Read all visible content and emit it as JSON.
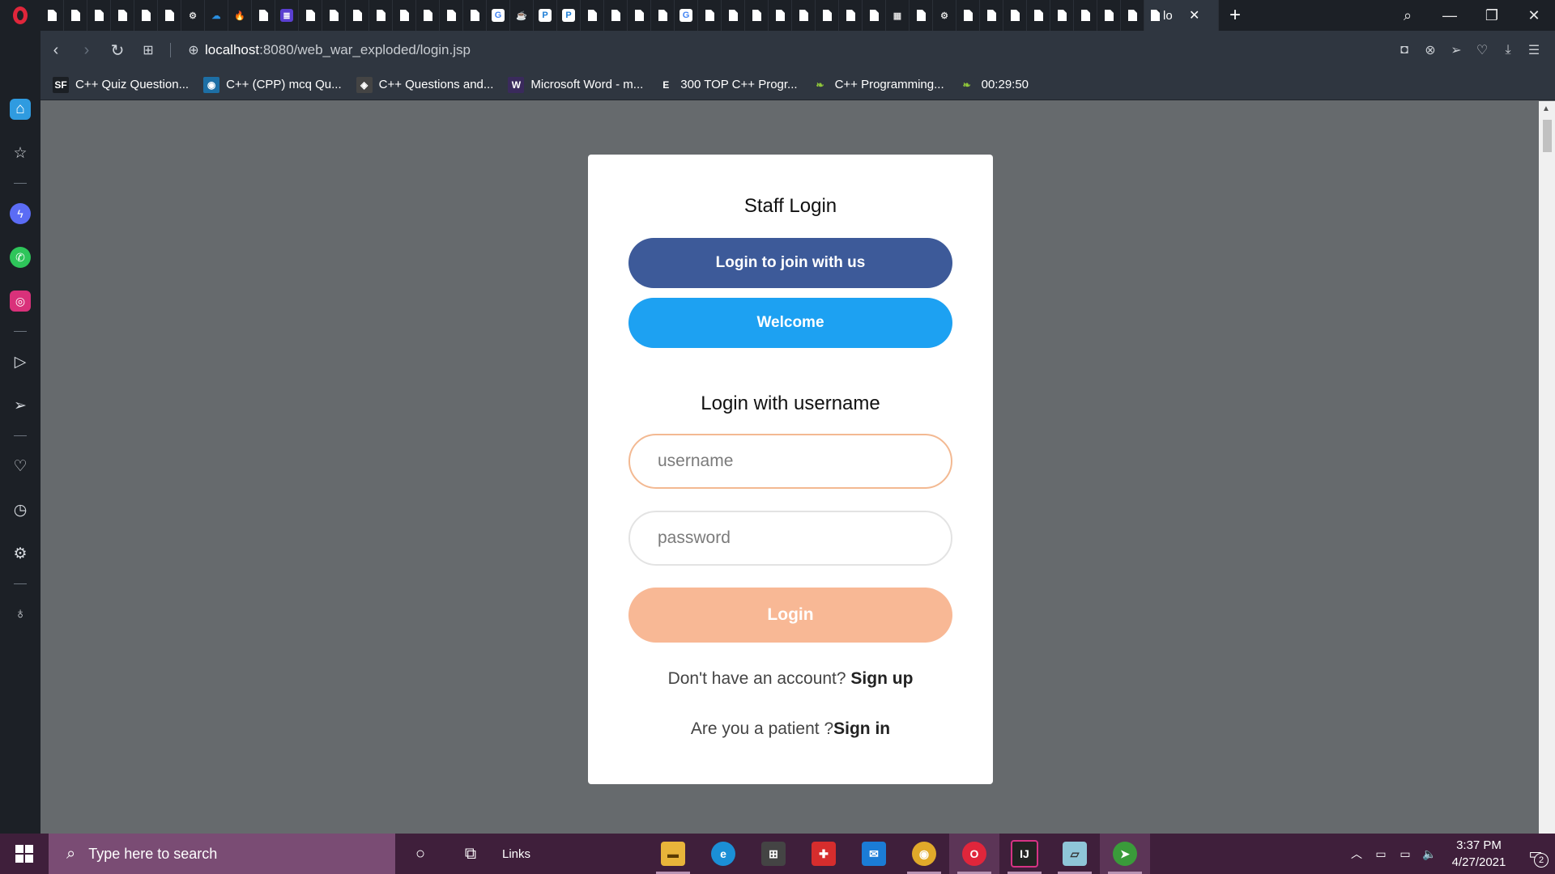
{
  "browser": {
    "tabs": [
      {
        "icon": "doc-icon"
      },
      {
        "icon": "doc-icon"
      },
      {
        "icon": "doc-icon"
      },
      {
        "icon": "doc-icon"
      },
      {
        "icon": "doc-icon"
      },
      {
        "icon": "doc-icon"
      },
      {
        "icon": "gear-icon"
      },
      {
        "icon": "cloud-icon"
      },
      {
        "icon": "fire-icon"
      },
      {
        "icon": "doc-icon"
      },
      {
        "icon": "list-icon"
      },
      {
        "icon": "doc-icon"
      },
      {
        "icon": "doc-icon"
      },
      {
        "icon": "doc-icon"
      },
      {
        "icon": "doc-icon"
      },
      {
        "icon": "doc-icon"
      },
      {
        "icon": "doc-icon"
      },
      {
        "icon": "doc-icon"
      },
      {
        "icon": "doc-icon"
      },
      {
        "icon": "google-icon"
      },
      {
        "icon": "java-icon"
      },
      {
        "icon": "p-icon"
      },
      {
        "icon": "p-icon"
      },
      {
        "icon": "doc-icon"
      },
      {
        "icon": "doc-icon"
      },
      {
        "icon": "doc-icon"
      },
      {
        "icon": "doc-icon"
      },
      {
        "icon": "google-icon"
      },
      {
        "icon": "doc-icon"
      },
      {
        "icon": "doc-icon"
      },
      {
        "icon": "doc-icon"
      },
      {
        "icon": "doc-icon"
      },
      {
        "icon": "doc-icon"
      },
      {
        "icon": "doc-icon"
      },
      {
        "icon": "doc-icon"
      },
      {
        "icon": "doc-icon"
      },
      {
        "icon": "grid-icon"
      },
      {
        "icon": "doc-icon"
      },
      {
        "icon": "gear-icon"
      },
      {
        "icon": "doc-icon"
      },
      {
        "icon": "doc-icon"
      },
      {
        "icon": "doc-icon"
      },
      {
        "icon": "doc-icon"
      },
      {
        "icon": "doc-icon"
      },
      {
        "icon": "doc-icon"
      },
      {
        "icon": "doc-icon"
      },
      {
        "icon": "doc-icon"
      }
    ],
    "active_tab_title": "lo",
    "address": {
      "host": "localhost",
      "path": ":8080/web_war_exploded/login.jsp"
    },
    "bookmarks": [
      {
        "label": "C++ Quiz Question...",
        "icon": "SF",
        "color": "#1b1f24"
      },
      {
        "label": "C++ (CPP) mcq Qu...",
        "icon": "◉",
        "color": "#1d6fa5"
      },
      {
        "label": "C++ Questions and...",
        "icon": "◈",
        "color": "#444"
      },
      {
        "label": "Microsoft Word - m...",
        "icon": "W",
        "color": "#3a2a5c"
      },
      {
        "label": "300 TOP C++ Progr...",
        "icon": "E",
        "color": "#2f3640"
      },
      {
        "label": "C++ Programming...",
        "icon": "❧",
        "color": "#2f3640"
      },
      {
        "label": "00:29:50",
        "icon": "❧",
        "color": "#2f3640"
      }
    ]
  },
  "page": {
    "title": "Staff Login",
    "primary_button": "Login to join with us",
    "secondary_button": "Welcome",
    "subtitle": "Login with username",
    "username_placeholder": "username",
    "password_placeholder": "password",
    "login_button": "Login",
    "signup_text": "Don't have an account? ",
    "signup_link": "Sign up",
    "patient_text": "Are you a patient ?",
    "patient_link": "Sign in",
    "colors": {
      "primary": "#3d5a99",
      "secondary": "#1da1f2",
      "login": "#f8b895"
    }
  },
  "taskbar": {
    "search_placeholder": "Type here to search",
    "links_label": "Links",
    "time": "3:37 PM",
    "date": "4/27/2021",
    "notifications": "2"
  }
}
